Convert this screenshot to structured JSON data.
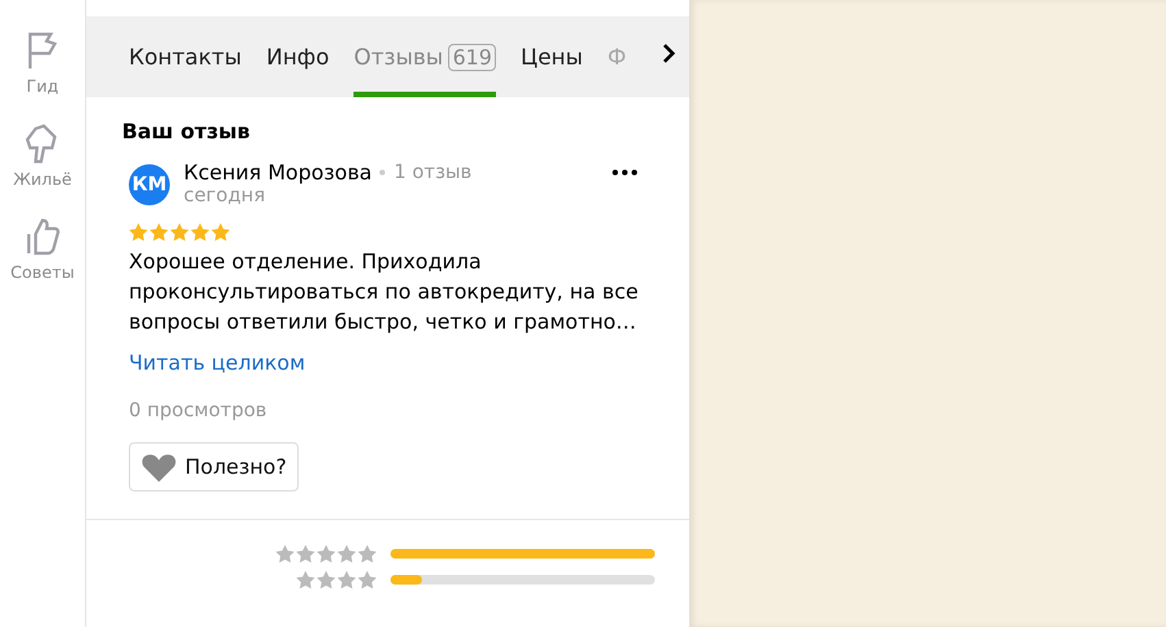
{
  "sidebar": {
    "items": [
      {
        "kind": "flag",
        "label": "Гид"
      },
      {
        "kind": "house",
        "label": "Жильё"
      },
      {
        "kind": "thumb",
        "label": "Советы"
      }
    ]
  },
  "tabs": [
    {
      "label": "Контакты",
      "selected": false,
      "faded": false
    },
    {
      "label": "Инфо",
      "selected": false,
      "faded": false
    },
    {
      "label": "Отзывы",
      "count": "619",
      "selected": true,
      "faded": false
    },
    {
      "label": "Цены",
      "selected": false,
      "faded": false
    },
    {
      "label": "Ф",
      "selected": false,
      "faded": true
    }
  ],
  "section_title": "Ваш отзыв",
  "review": {
    "initials": "КМ",
    "author": "Ксения Морозова",
    "author_reviews": "1 отзыв",
    "date": "сегодня",
    "stars": 5,
    "text": "Хорошее отделение. Приходила проконсультироваться по автокредиту, на все вопросы ответили быстро, четко и грамотно…",
    "read_more": "Читать целиком",
    "views": "0 просмотров",
    "useful": "Полезно?"
  },
  "summary": {
    "rows": [
      {
        "kind": "five",
        "level": 1
      },
      {
        "kind": "four",
        "level": 0.12
      }
    ]
  }
}
